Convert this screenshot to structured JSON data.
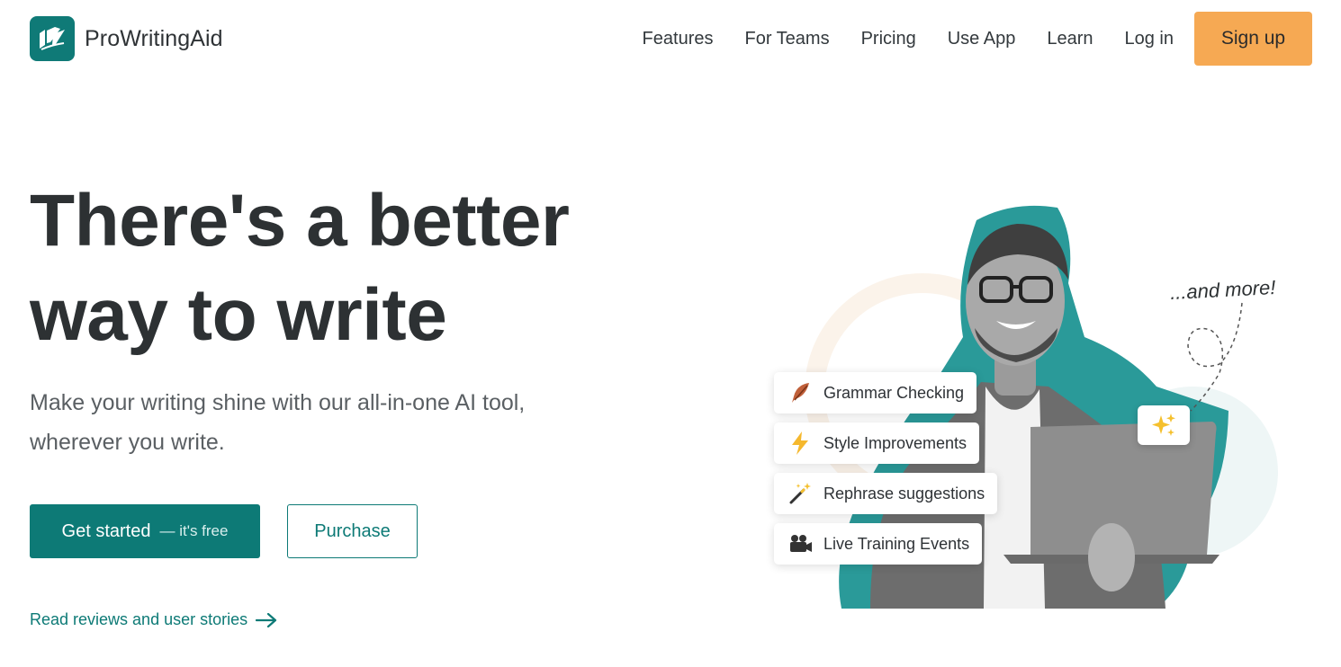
{
  "brand": {
    "name": "ProWritingAid",
    "logo_icon": "feather-pages-logo",
    "color": "#0f7a77"
  },
  "nav": {
    "items": [
      "Features",
      "For Teams",
      "Pricing",
      "Use App",
      "Learn",
      "Log in"
    ],
    "signup_label": "Sign up",
    "signup_color": "#f6a953"
  },
  "hero": {
    "headline_line1": "There's a better",
    "headline_line2": "way to write",
    "subtitle": "Make your writing shine with our all-in-one AI tool, wherever you write.",
    "cta_primary": "Get started",
    "cta_primary_note": "— it's free",
    "cta_secondary": "Purchase",
    "reviews_link": "Read reviews and user stories",
    "accent_color": "#0d7a76"
  },
  "illustration": {
    "features": [
      {
        "label": "Grammar Checking",
        "icon": "feather-icon"
      },
      {
        "label": "Style Improvements",
        "icon": "lightning-icon"
      },
      {
        "label": "Rephrase suggestions",
        "icon": "magic-wand-icon"
      },
      {
        "label": "Live Training Events",
        "icon": "video-camera-icon"
      }
    ],
    "more_text": "...and more!",
    "badge_icon": "sparkles-icon"
  }
}
